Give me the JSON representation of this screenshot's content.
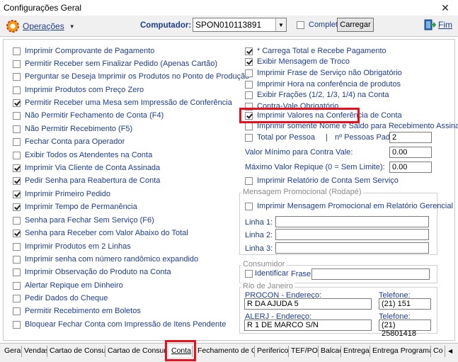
{
  "window": {
    "title": "Configurações Geral",
    "close_glyph": "✕"
  },
  "toolbar": {
    "operacoes_label": "Operações",
    "computador_label": "Computador:",
    "computador_value": "SPON010113891",
    "completo_label": "Completo",
    "completo_checked": false,
    "carregar_label": "Carregar",
    "fim_label": "Fim"
  },
  "left_options": [
    {
      "label": "Imprimir Comprovante de Pagamento",
      "checked": false
    },
    {
      "label": "Permitir Receber sem Finalizar Pedido (Apenas Cartão)",
      "checked": false
    },
    {
      "label": "Perguntar se Deseja Imprimir os Produtos no Ponto de Produção",
      "checked": false
    },
    {
      "label": "Imprimir Produtos com Preço Zero",
      "checked": false
    },
    {
      "label": "Permitir Receber uma Mesa sem Impressão de Conferência",
      "checked": true
    },
    {
      "label": "Não Permitir Fechamento de Conta (F4)",
      "checked": false
    },
    {
      "label": "Não Permitir Recebimento (F5)",
      "checked": false
    },
    {
      "label": "Fechar Conta para Operador",
      "checked": false
    },
    {
      "label": "Exibir Todos os Atendentes na Conta",
      "checked": false
    },
    {
      "label": "Imprimir Via Cliente de Conta Assinada",
      "checked": true
    },
    {
      "label": "Pedir Senha para Reabertura de Conta",
      "checked": true
    },
    {
      "label": "Imprimir Primeiro Pedido",
      "checked": true
    },
    {
      "label": "Imprimir Tempo de Permanência",
      "checked": true
    },
    {
      "label": "Senha para Fechar Sem Serviço (F6)",
      "checked": false
    },
    {
      "label": "Senha para Receber com Valor Abaixo do Total",
      "checked": true
    },
    {
      "label": "Imprimir Produtos em 2 Linhas",
      "checked": false
    },
    {
      "label": "Imprimir senha com número randômico expandido",
      "checked": false
    },
    {
      "label": "Imprimir Observação do Produto na Conta",
      "checked": false
    },
    {
      "label": "Alertar Repique em Dinheiro",
      "checked": false
    },
    {
      "label": "Pedir Dados do Cheque",
      "checked": false
    },
    {
      "label": "Permitir Recebimento em Boletos",
      "checked": false
    },
    {
      "label": "Bloquear Fechar Conta com Impressão de Itens Pendente",
      "checked": false
    }
  ],
  "right_options": [
    {
      "label": "* Carrega Total e Recebe Pagamento",
      "checked": true
    },
    {
      "label": "Exibir Mensagem de Troco",
      "checked": true
    },
    {
      "label": "Imprimir Frase de Serviço não Obrigatório",
      "checked": false
    },
    {
      "label": "Imprimir Hora na conferência de produtos",
      "checked": false
    },
    {
      "label": "Exibir Frações (1/2, 1/3, 1/4) na Conta",
      "checked": false
    },
    {
      "label": "Contra-Vale Obrigatório",
      "checked": false
    },
    {
      "label": "Imprimir Valores na Conferência de Conta",
      "checked": true
    },
    {
      "label": "Imprimir somente Nome e Saldo para Recebimento Assinada",
      "checked": false
    }
  ],
  "total_pessoa": {
    "label": "Total por Pessoa",
    "checked": false,
    "separator": "|",
    "pessoas_label": "nº Pessoas Padrão:",
    "pessoas_value": "2"
  },
  "valor_minimo": {
    "label": "Valor Mínimo para Contra Vale:",
    "value": "0.00"
  },
  "valor_repique": {
    "label": "Máximo Valor Repique (0 = Sem Limite):",
    "value": "0.00"
  },
  "relatorio_sem_servico": {
    "label": "Imprimir Relatório de Conta Sem Serviço",
    "checked": false
  },
  "mensagem_group": {
    "title": "Mensagem Promocional (Rodapé)",
    "checkbox_label": "Imprimir Mensagem Promocional em Relatório Gerencial",
    "checked": false,
    "linha1_label": "Linha 1:",
    "linha1_value": "",
    "linha2_label": "Linha 2:",
    "linha2_value": "",
    "linha3_label": "Linha 3:",
    "linha3_value": ""
  },
  "consumidor_group": {
    "title": "Consumidor",
    "identificar_label": "Identificar",
    "identificar_checked": false,
    "frase_label": "Frase:",
    "frase_value": ""
  },
  "rio_group": {
    "title": "Rio de Janeiro",
    "procon_label": "PROCON - Endereço:",
    "procon_value": "R DA AJUDA 5",
    "procon_tel_label": "Telefone:",
    "procon_tel_value": "(21) 151",
    "alerj_label": "ALERJ - Endereço:",
    "alerj_value": "R 1 DE MARCO S/N",
    "alerj_tel_label": "Telefone:",
    "alerj_tel_value": "(21) 25801418"
  },
  "tabs": [
    {
      "label": "Geral"
    },
    {
      "label": "Vendas"
    },
    {
      "label": "Cartao de Consumo"
    },
    {
      "label": "Cartao de Consumo"
    },
    {
      "label": "Conta",
      "active": true
    },
    {
      "label": "Fechamento de Caixa"
    },
    {
      "label": "Perifericos"
    },
    {
      "label": "TEF/POS"
    },
    {
      "label": "Balcao"
    },
    {
      "label": "Entregas"
    },
    {
      "label": "Entrega Programada"
    },
    {
      "label": "Co"
    }
  ],
  "colors": {
    "label_blue": "#1c3c8c",
    "highlight_red": "#e8101c"
  }
}
